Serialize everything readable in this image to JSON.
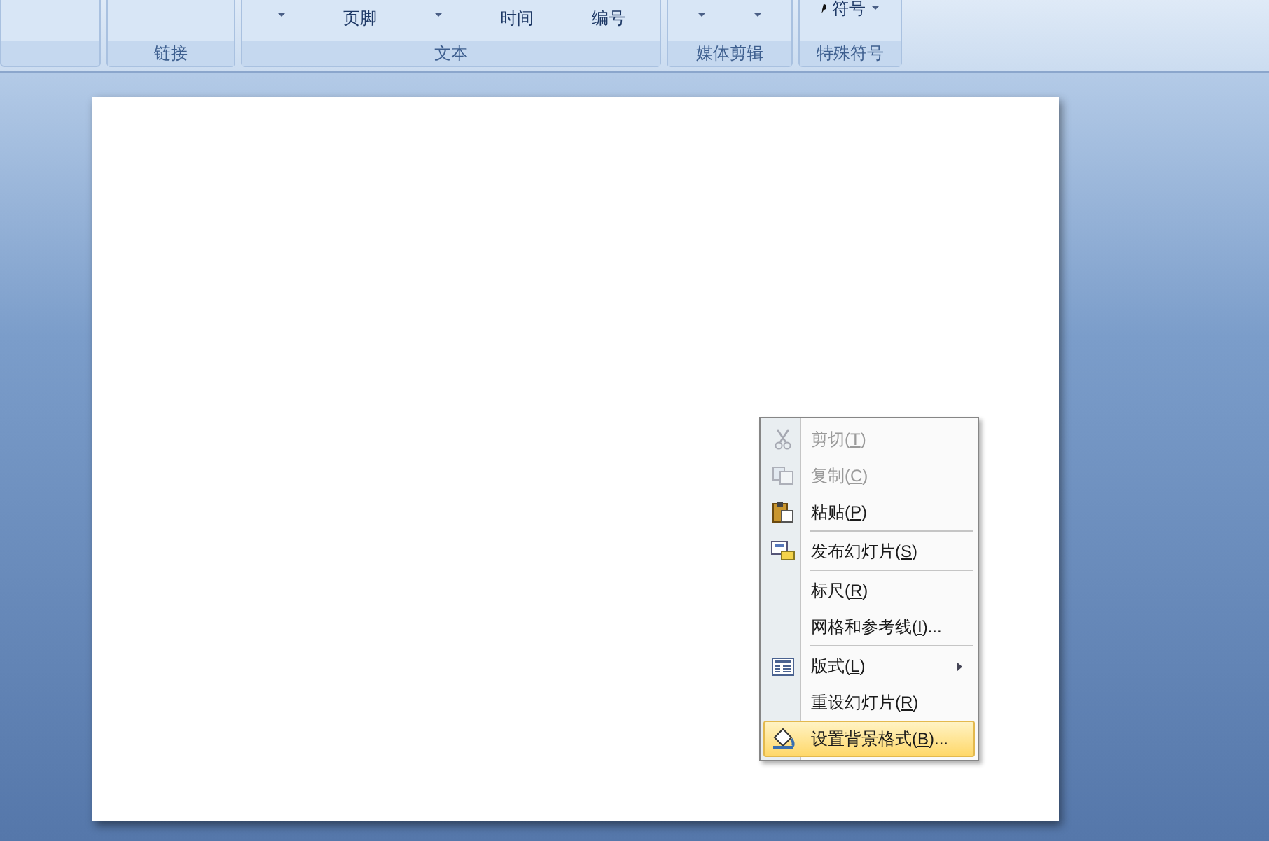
{
  "ribbon": {
    "groups": [
      {
        "label": "链接"
      },
      {
        "label": "文本",
        "buttons": [
          {
            "kind": "arrow"
          },
          {
            "kind": "text",
            "text": "页脚"
          },
          {
            "kind": "arrow"
          },
          {
            "kind": "text",
            "text": "时间"
          },
          {
            "kind": "text",
            "text": "编号"
          }
        ]
      },
      {
        "label": "媒体剪辑",
        "buttons": [
          {
            "kind": "arrow"
          },
          {
            "kind": "arrow"
          }
        ]
      },
      {
        "label": "特殊符号",
        "buttons": [
          {
            "kind": "symbol",
            "text": "符号"
          }
        ]
      }
    ]
  },
  "context_menu": {
    "items": [
      {
        "prefix": "剪切(",
        "key": "T",
        "suffix": ")",
        "disabled": true,
        "selected": false,
        "submenu": false,
        "divider_after": false
      },
      {
        "prefix": "复制(",
        "key": "C",
        "suffix": ")",
        "disabled": true,
        "selected": false,
        "submenu": false,
        "divider_after": false
      },
      {
        "prefix": "粘贴(",
        "key": "P",
        "suffix": ")",
        "disabled": false,
        "selected": false,
        "submenu": false,
        "divider_after": true
      },
      {
        "prefix": "发布幻灯片(",
        "key": "S",
        "suffix": ")",
        "disabled": false,
        "selected": false,
        "submenu": false,
        "divider_after": true
      },
      {
        "prefix": "标尺(",
        "key": "R",
        "suffix": ")",
        "disabled": false,
        "selected": false,
        "submenu": false,
        "divider_after": false
      },
      {
        "prefix": "网格和参考线(",
        "key": "I",
        "suffix": ")...",
        "disabled": false,
        "selected": false,
        "submenu": false,
        "divider_after": true
      },
      {
        "prefix": "版式(",
        "key": "L",
        "suffix": ")",
        "disabled": false,
        "selected": false,
        "submenu": true,
        "divider_after": false
      },
      {
        "prefix": "重设幻灯片(",
        "key": "R",
        "suffix": ")",
        "disabled": false,
        "selected": false,
        "submenu": false,
        "divider_after": false
      },
      {
        "prefix": "设置背景格式(",
        "key": "B",
        "suffix": ")...",
        "disabled": false,
        "selected": true,
        "submenu": false,
        "divider_after": false
      }
    ]
  }
}
